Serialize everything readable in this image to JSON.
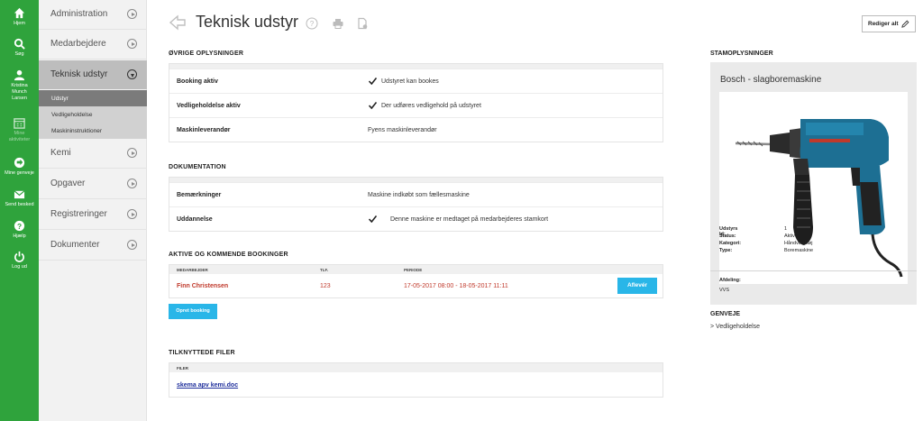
{
  "rail": {
    "items": [
      {
        "label": "Hjem",
        "icon": "home-icon"
      },
      {
        "label": "Søg",
        "icon": "search-icon"
      },
      {
        "label": "Kristina Munch Larsen",
        "icon": "user-icon"
      },
      {
        "label": "Mine aktiviteter",
        "icon": "calendar-icon"
      },
      {
        "label": "Mine genveje",
        "icon": "shortcut-icon"
      },
      {
        "label": "Send besked",
        "icon": "mail-icon"
      },
      {
        "label": "Hjælp",
        "icon": "help-icon"
      },
      {
        "label": "Log ud",
        "icon": "power-icon"
      }
    ],
    "user_lines": [
      "Kristina",
      "Munch",
      "Larsen"
    ],
    "activities_lines": [
      "Mine",
      "aktiviteter"
    ]
  },
  "nav": {
    "items": [
      {
        "label": "Administration"
      },
      {
        "label": "Medarbejdere"
      },
      {
        "label": "Teknisk udstyr"
      },
      {
        "label": "Kemi"
      },
      {
        "label": "Opgaver"
      },
      {
        "label": "Registreringer"
      },
      {
        "label": "Dokumenter"
      }
    ],
    "subitems": [
      {
        "label": "Udstyr"
      },
      {
        "label": "Vedligeholdelse"
      },
      {
        "label": "Maskininstruktioner"
      }
    ]
  },
  "header": {
    "title": "Teknisk udstyr",
    "edit_label": "Rediger alt"
  },
  "sections": {
    "ovrige": {
      "title": "ØVRIGE OPLYSNINGER",
      "rows": [
        {
          "key": "Booking aktiv",
          "value": "Udstyret kan bookes"
        },
        {
          "key": "Vedligeholdelse aktiv",
          "value": "Der udføres vedligehold på udstyret"
        },
        {
          "key": "Maskinleverandør",
          "value": "Fyens maskinleverandør"
        }
      ]
    },
    "dokumentation": {
      "title": "DOKUMENTATION",
      "rows": [
        {
          "key": "Bemærkninger",
          "value": "Maskine indkøbt som fællesmaskine"
        },
        {
          "key": "Uddannelse",
          "value": "Denne maskine er medtaget på medarbejderes stamkort"
        }
      ]
    },
    "bookinger": {
      "title": "AKTIVE OG KOMMENDE BOOKINGER",
      "columns": [
        "MEDARBEJDER",
        "TLF.",
        "PERIODE"
      ],
      "rows": [
        {
          "medarbejder": "Finn Christensen",
          "tlf": "123",
          "periode": "17-05-2017 08:00 - 18-05-2017 11:11",
          "action": "Aflevér"
        }
      ],
      "create_label": "Opret booking"
    },
    "filer": {
      "title": "TILKNYTTEDE FILER",
      "column": "FILER",
      "files": [
        "skema apv kemi.doc"
      ]
    }
  },
  "stamdata": {
    "title": "STAMOPLYSNINGER",
    "name": "Bosch - slagboremaskine",
    "props": [
      {
        "key": "Udstyrs Id:",
        "value": "1"
      },
      {
        "key": "Status:",
        "value": "Aktiv"
      },
      {
        "key": "Kategori:",
        "value": "Håndværktøj"
      },
      {
        "key": "Type:",
        "value": "Boremaskine"
      }
    ],
    "afdeling_label": "Afdeling:",
    "afdeling_value": "VVS"
  },
  "genveje": {
    "title": "GENVEJE",
    "link": "> Vedligeholdelse"
  },
  "colors": {
    "rail_green": "#2fa33c",
    "accent_blue": "#29b6e8",
    "booking_red": "#c0392b",
    "link_blue": "#1f2f9c"
  }
}
